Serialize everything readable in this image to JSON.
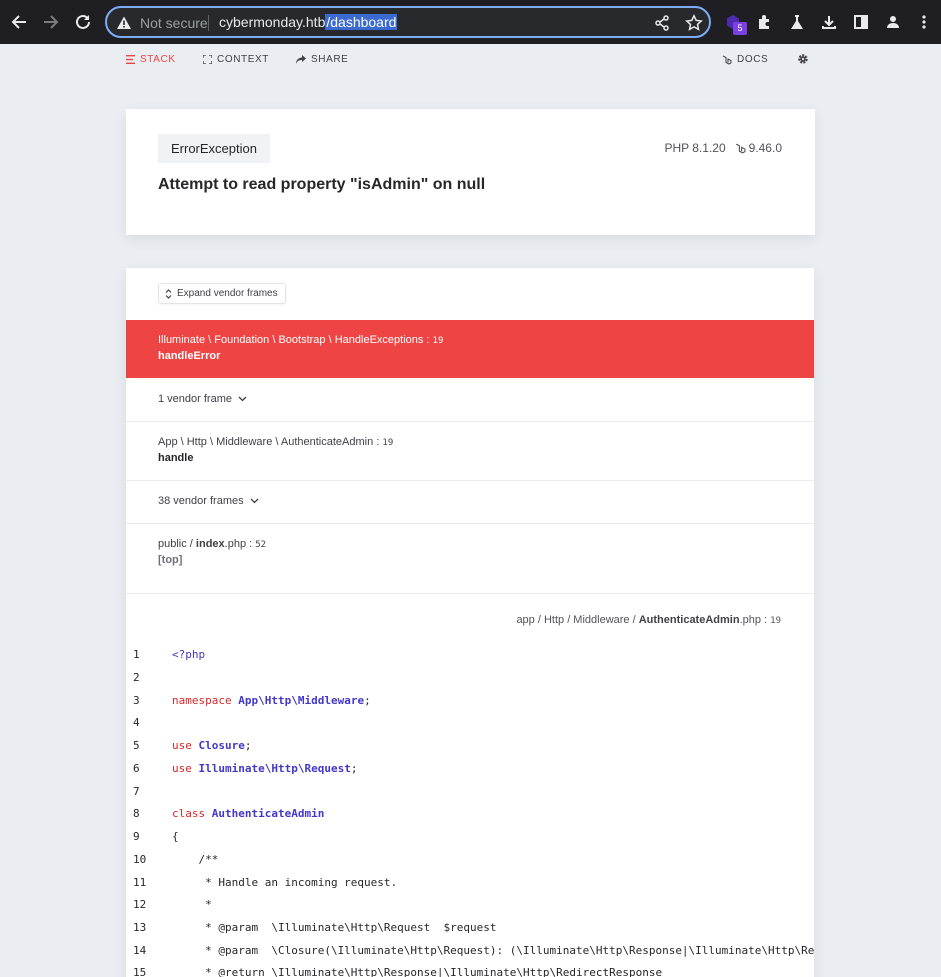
{
  "browser": {
    "security_label": "Not secure",
    "url_host": "cybermonday.htb",
    "url_path": "/dashboard",
    "extension_badge": "5"
  },
  "toolbar": {
    "tabs": [
      {
        "label": "STACK",
        "icon": "stack-icon"
      },
      {
        "label": "CONTEXT",
        "icon": "expand-icon"
      },
      {
        "label": "SHARE",
        "icon": "share-icon"
      }
    ],
    "docs_label": "DOCS"
  },
  "error": {
    "exception_class": "ErrorException",
    "php_version": "PHP 8.1.20",
    "laravel_version": "9.46.0",
    "message": "Attempt to read property \"isAdmin\" on null"
  },
  "stack": {
    "expand_label": "Expand vendor frames",
    "frames": [
      {
        "class": "Illuminate \\ Foundation \\ Bootstrap \\ HandleExceptions",
        "line": "19",
        "method": "handleError",
        "selected": true
      },
      {
        "vendor_label": "1 vendor frame"
      },
      {
        "class": "App \\ Http \\ Middleware \\ AuthenticateAdmin",
        "line": "19",
        "method": "handle"
      },
      {
        "vendor_label": "38 vendor frames"
      },
      {
        "path_prefix": "public / ",
        "file": "index",
        "ext": ".php",
        "line": "52",
        "method": "[top]"
      }
    ]
  },
  "code": {
    "file_path": "app / Http / Middleware / ",
    "file_name": "AuthenticateAdmin",
    "file_ext": ".php",
    "line": "19",
    "lines": [
      {
        "n": "1"
      },
      {
        "n": "2"
      },
      {
        "n": "3"
      },
      {
        "n": "4"
      },
      {
        "n": "5"
      },
      {
        "n": "6"
      },
      {
        "n": "7"
      },
      {
        "n": "8"
      },
      {
        "n": "9"
      },
      {
        "n": "10"
      },
      {
        "n": "11"
      },
      {
        "n": "12"
      },
      {
        "n": "13"
      },
      {
        "n": "14"
      },
      {
        "n": "15"
      }
    ],
    "tokens": {
      "php_open": "<?php",
      "namespace_kw": "namespace",
      "namespace_name": "App\\Http\\Middleware",
      "semicolon": ";",
      "use_kw": "use",
      "use1": "Closure",
      "use2": "Illuminate\\Http\\Request",
      "class_kw": "class",
      "class_name": "AuthenticateAdmin",
      "brace": "{",
      "doc_open": "    /**",
      "doc_line": "     * Handle an incoming request.",
      "doc_star": "     *",
      "doc_param1": "     * @param  \\Illuminate\\Http\\Request  $request",
      "doc_param2": "     * @param  \\Closure(\\Illuminate\\Http\\Request): (\\Illuminate\\Http\\Response|\\Illuminate\\Http\\RedirectResponse)  $next",
      "doc_return": "     * @return \\Illuminate\\Http\\Response|\\Illuminate\\Http\\RedirectResponse"
    }
  }
}
